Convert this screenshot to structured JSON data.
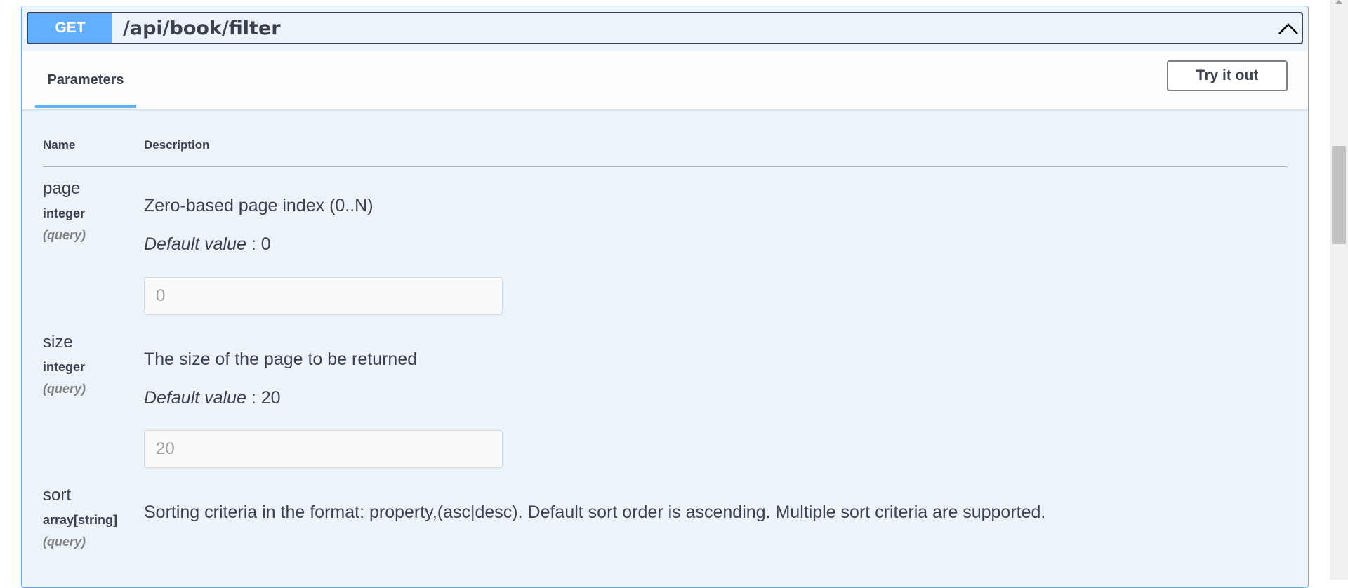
{
  "endpoint": {
    "method": "GET",
    "path": "/api/book/filter",
    "collapse_icon": "chevron-up-icon"
  },
  "tabs": {
    "parameters_label": "Parameters"
  },
  "try_button_label": "Try it out",
  "table": {
    "name_header": "Name",
    "description_header": "Description"
  },
  "params": [
    {
      "name": "page",
      "type": "integer",
      "location": "(query)",
      "description": "Zero-based page index (0..N)",
      "default_label": "Default value",
      "default_sep": " : ",
      "default_value": "0",
      "placeholder": "0"
    },
    {
      "name": "size",
      "type": "integer",
      "location": "(query)",
      "description": "The size of the page to be returned",
      "default_label": "Default value",
      "default_sep": " : ",
      "default_value": "20",
      "placeholder": "20"
    },
    {
      "name": "sort",
      "type": "array[string]",
      "location": "(query)",
      "description": "Sorting criteria in the format: property,(asc|desc). Default sort order is ascending. Multiple sort criteria are supported."
    }
  ],
  "colors": {
    "get_method": "#61affe",
    "block_bg": "#ebf3fb",
    "text": "#3b4151"
  }
}
